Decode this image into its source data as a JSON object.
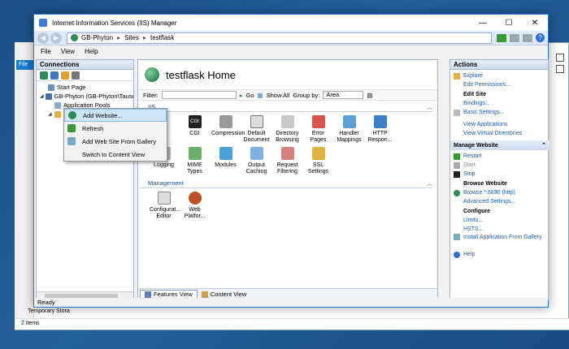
{
  "window": {
    "title": "Internet Information Services (IIS) Manager",
    "minimize": "—",
    "maximize": "☐",
    "close": "✕"
  },
  "address": {
    "back": "◀",
    "forward": "▶",
    "parts": [
      "GB-Phyton",
      "Sites",
      "testflask"
    ],
    "separator": "▸"
  },
  "menu": [
    "File",
    "View",
    "Help"
  ],
  "connections": {
    "title": "Connections",
    "tree": [
      {
        "label": "Start Page",
        "icon": "start-page-icon"
      },
      {
        "label": "GB-Phyton (GB-Phyton\\Tause",
        "icon": "server-icon",
        "expander": "◢"
      },
      {
        "label": "Application Pools",
        "icon": "app-pools-icon"
      },
      {
        "label": "",
        "icon": "sites-icon",
        "expander": "◢"
      }
    ]
  },
  "main": {
    "title": "testflask Home",
    "filter_label": "Filter:",
    "go_label": "Go",
    "show_all_label": "Show All",
    "group_by_label": "Group by:",
    "group_by_value": "Area",
    "sections": [
      {
        "name": "IIS",
        "features": [
          {
            "label": "",
            "icon": "hidden-icon"
          },
          {
            "label": "CGI",
            "icon": "cgi-icon"
          },
          {
            "label": "Compression",
            "icon": "compression-icon"
          },
          {
            "label": "Default Document",
            "icon": "default-document-icon"
          },
          {
            "label": "Directory Browsing",
            "icon": "directory-browsing-icon"
          },
          {
            "label": "Error Pages",
            "icon": "error-pages-icon"
          },
          {
            "label": "Handler Mappings",
            "icon": "handler-mappings-icon"
          },
          {
            "label": "HTTP Respon...",
            "icon": "http-response-icon"
          },
          {
            "label": "Logging",
            "icon": "logging-icon"
          },
          {
            "label": "MIME Types",
            "icon": "mime-types-icon"
          },
          {
            "label": "Modules",
            "icon": "modules-icon"
          },
          {
            "label": "Output Caching",
            "icon": "output-caching-icon"
          },
          {
            "label": "Request Filtering",
            "icon": "request-filtering-icon"
          },
          {
            "label": "SSL Settings",
            "icon": "ssl-settings-icon"
          }
        ]
      },
      {
        "name": "Management",
        "features": [
          {
            "label": "Configurat... Editor",
            "icon": "config-editor-icon"
          },
          {
            "label": "Web Platfor...",
            "icon": "web-platform-icon"
          }
        ]
      }
    ],
    "tabs": [
      {
        "label": "Features View"
      },
      {
        "label": "Content View"
      }
    ]
  },
  "actions": {
    "title": "Actions",
    "explore": "Explore",
    "edit_permissions": "Edit Permissions...",
    "edit_site": "Edit Site",
    "bindings": "Bindings...",
    "basic_settings": "Basic Settings...",
    "view_applications": "View Applications",
    "view_virtual_directories": "View Virtual Directories",
    "manage_website": "Manage Website",
    "restart": "Restart",
    "start": "Start",
    "stop": "Stop",
    "browse_website": "Browse Website",
    "browse_link": "Browse *:6830 (http)",
    "advanced_settings": "Advanced Settings...",
    "configure": "Configure",
    "limits": "Limits...",
    "hsts": "HSTS...",
    "install_from_gallery": "Install Application From Gallery",
    "help": "Help"
  },
  "context_menu": [
    {
      "label": "Add Website...",
      "highlighted": true
    },
    {
      "label": "Refresh"
    },
    {
      "label": "Add Web Site From Gallery"
    },
    {
      "label": "Switch to Content View"
    }
  ],
  "status": "Ready",
  "background": {
    "file_label": "File",
    "temporary_storage": "Temporary Stora",
    "items": "2 items"
  }
}
